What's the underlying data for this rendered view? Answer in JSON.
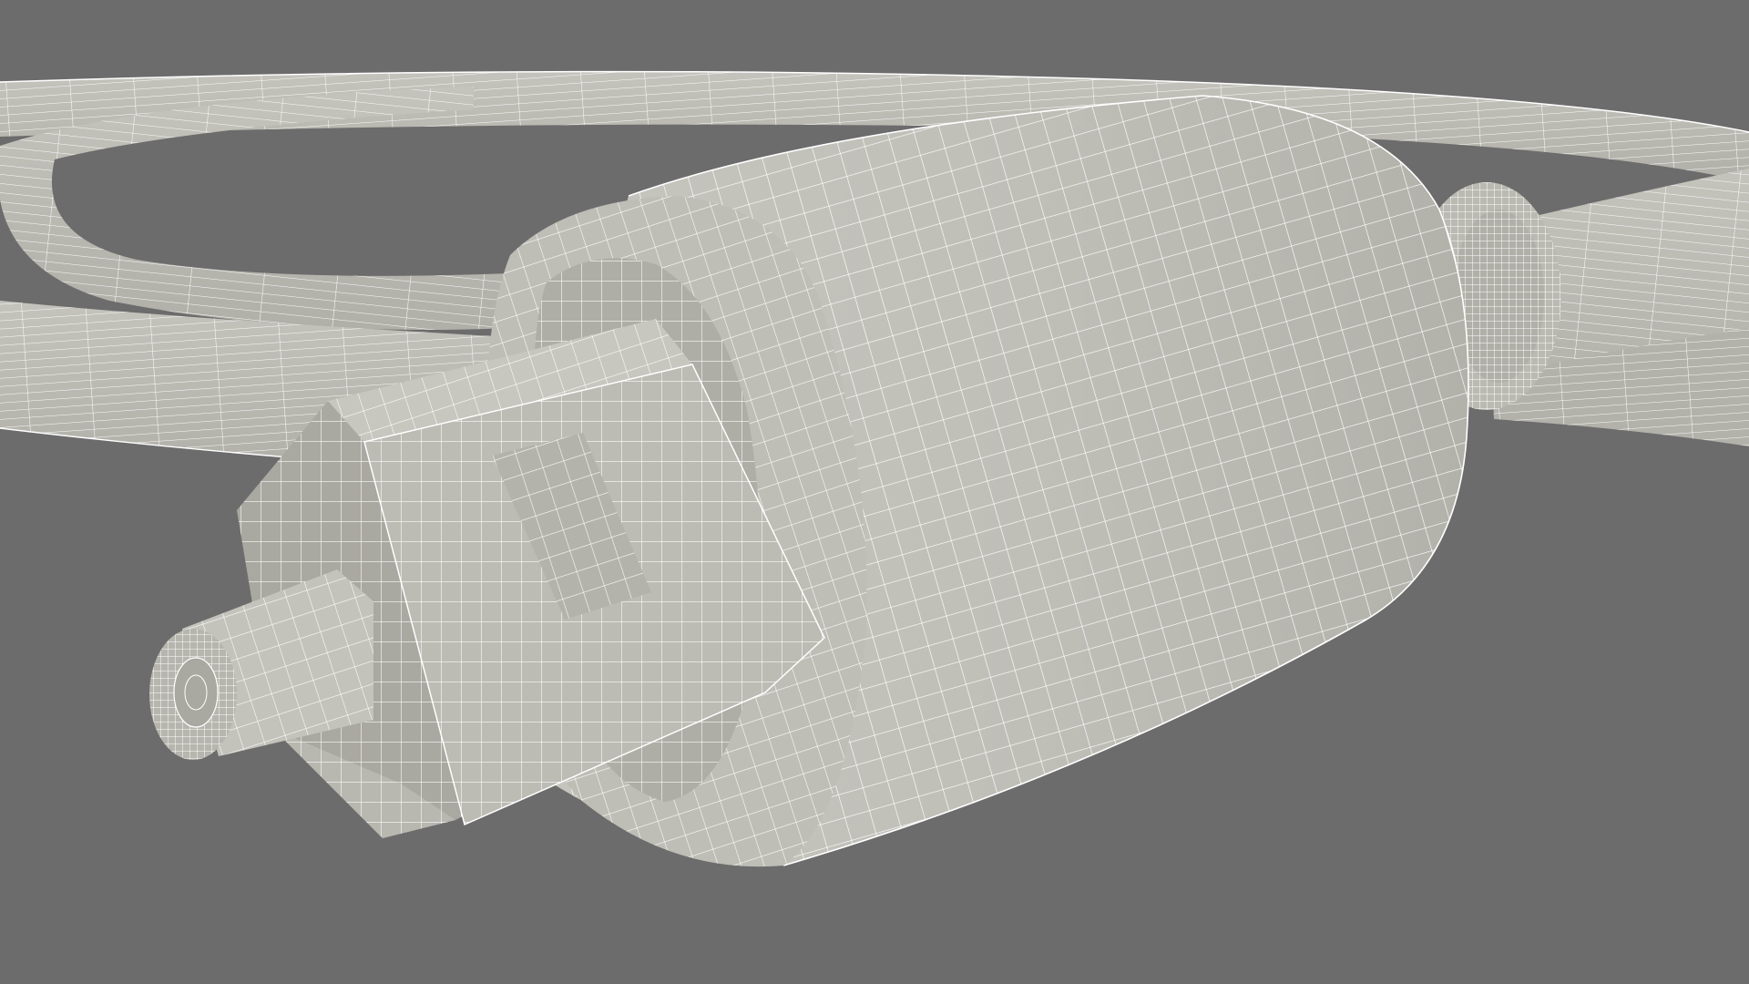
{
  "scene": {
    "background_color": "#6c6c6c",
    "surface_color": "#bdbcb5",
    "shadow_color": "#a4a39c",
    "wire_color": "#ffffff"
  }
}
